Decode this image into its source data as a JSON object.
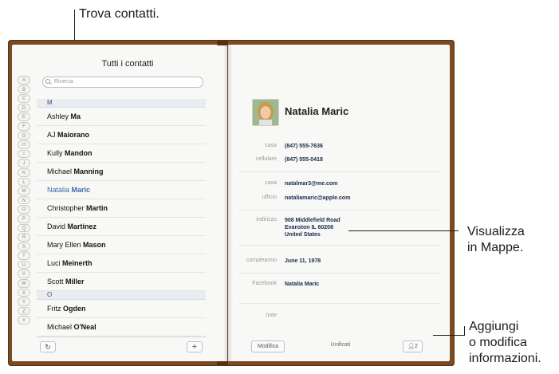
{
  "callouts": {
    "find": "Trova contatti.",
    "maps_line1": "Visualizza",
    "maps_line2": "in Mappe.",
    "edit_line1": "Aggiungi",
    "edit_line2": "o modifica",
    "edit_line3": "informazioni."
  },
  "left": {
    "title": "Tutti i contatti",
    "search_placeholder": "Ricerca",
    "index_letters": [
      "A",
      "B",
      "C",
      "D",
      "E",
      "F",
      "G",
      "H",
      "I",
      "J",
      "K",
      "L",
      "M",
      "N",
      "O",
      "P",
      "Q",
      "R",
      "S",
      "T",
      "U",
      "V",
      "W",
      "X",
      "Y",
      "Z",
      "#"
    ],
    "sections": [
      {
        "letter": "M",
        "contacts": [
          {
            "first": "Ashley",
            "last": "Ma"
          },
          {
            "first": "AJ",
            "last": "Maiorano"
          },
          {
            "first": "Kully",
            "last": "Mandon"
          },
          {
            "first": "Michael",
            "last": "Manning"
          },
          {
            "first": "Natalia",
            "last": "Maric",
            "selected": true
          },
          {
            "first": "Christopher",
            "last": "Martin"
          },
          {
            "first": "David",
            "last": "Martinez"
          },
          {
            "first": "Mary Ellen",
            "last": "Mason"
          },
          {
            "first": "Luci",
            "last": "Meinerth"
          },
          {
            "first": "Scott",
            "last": "Miller"
          }
        ]
      },
      {
        "letter": "O",
        "contacts": [
          {
            "first": "Fritz",
            "last": "Ogden"
          },
          {
            "first": "Michael",
            "last": "O'Neal"
          }
        ]
      }
    ],
    "refresh_icon": "refresh-icon",
    "add_label": "+"
  },
  "right": {
    "name": "Natalia Maric",
    "phone_home_label": "casa",
    "phone_home": "(847) 555-7636",
    "phone_cell_label": "cellulare",
    "phone_cell": "(847) 555-0418",
    "email_home_label": "casa",
    "email_home": "natalmar3@me.com",
    "email_work_label": "ufficio",
    "email_work": "nataliamaric@apple.com",
    "address_label": "indirizzo",
    "address_line1": "908 Middlefield Road",
    "address_line2": "Evanston IL 60208",
    "address_line3": "United States",
    "birthday_label": "compleanno",
    "birthday": "June 11, 1978",
    "facebook_label": "Facebook",
    "facebook": "Natalia Maric",
    "note_label": "note",
    "edit_label": "Modifica",
    "unified_label": "Unificati",
    "linked_count": "2"
  },
  "colors": {
    "book_cover": "#7a4a21",
    "page": "#f8f8f6",
    "selected_text": "#3e6bb0"
  }
}
